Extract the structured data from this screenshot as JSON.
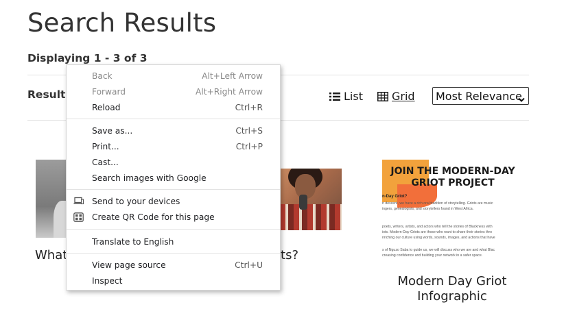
{
  "page": {
    "title": "Search Results",
    "displaying": "Displaying 1 - 3 of 3",
    "results_label": "Results"
  },
  "views": {
    "list_label": "List",
    "grid_label": "Grid"
  },
  "sort": {
    "selected": "Most Relevance"
  },
  "cards": [
    {
      "title": "What"
    },
    {
      "title": "ots?"
    },
    {
      "title_line1": "Modern Day Griot",
      "title_line2": "Infographic"
    }
  ],
  "infographic": {
    "heading_line1": "JOIN THE MODERN-DAY",
    "heading_line2": "GRIOT PROJECT",
    "subheading": "n-Day Griot?",
    "para1_line1": "n descent, we have a rich oral tradition of storytelling. Griots are music",
    "para1_line2": "ingers, genealogists, and storytellers found in West Africa.",
    "para2_line1": "poets, writers, artists, and actors who tell the stories of Blackness with",
    "para2_line2": "iots. Modern-Day Griots are those who want to share their stories thro",
    "para2_line3": "nriching our culture using words, sounds, images, and actions that have",
    "para3_line1": "s of Nguzo Saba to guide us, we will discuss who we are and what Blac",
    "para3_line2": "creasing confidence and building your network in a safer space."
  },
  "context_menu": {
    "items": [
      {
        "label": "Back",
        "shortcut": "Alt+Left Arrow"
      },
      {
        "label": "Forward",
        "shortcut": "Alt+Right Arrow"
      },
      {
        "label": "Reload",
        "shortcut": "Ctrl+R"
      },
      {
        "label": "Save as...",
        "shortcut": "Ctrl+S"
      },
      {
        "label": "Print...",
        "shortcut": "Ctrl+P"
      },
      {
        "label": "Cast...",
        "shortcut": ""
      },
      {
        "label": "Search images with Google",
        "shortcut": ""
      },
      {
        "label": "Send to your devices",
        "shortcut": "",
        "icon": "devices-icon"
      },
      {
        "label": "Create QR Code for this page",
        "shortcut": "",
        "icon": "qr-code-icon"
      },
      {
        "label": "Translate to English",
        "shortcut": ""
      },
      {
        "label": "View page source",
        "shortcut": "Ctrl+U"
      },
      {
        "label": "Inspect",
        "shortcut": ""
      }
    ]
  },
  "colors": {
    "text": "#333333",
    "menu_disabled": "#8a8a8a",
    "divider": "#e2e2e2",
    "infographic_orange": "#f2a23c",
    "infographic_red_orange": "#f26f3a"
  }
}
